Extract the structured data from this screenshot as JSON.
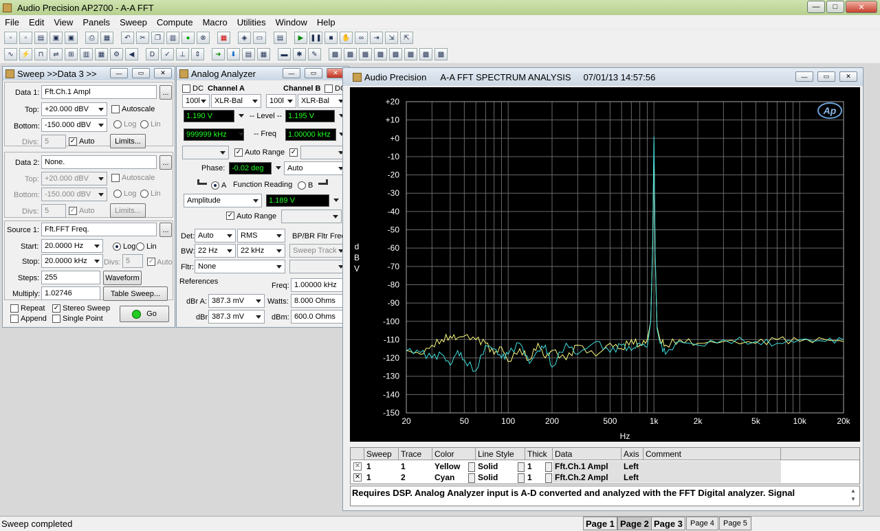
{
  "app": {
    "title": "Audio Precision AP2700 - A-A FFT"
  },
  "menu": [
    "File",
    "Edit",
    "View",
    "Panels",
    "Sweep",
    "Compute",
    "Macro",
    "Utilities",
    "Window",
    "Help"
  ],
  "sweep_panel": {
    "title": "Sweep >>Data 3 >>",
    "data1_label": "Data 1:",
    "data1_value": "Fft.Ch.1 Ampl",
    "top_label": "Top:",
    "top_value": "+20.000  dBV",
    "bottom_label": "Bottom:",
    "bottom_value": "-150.000 dBV",
    "divs_label": "Divs:",
    "divs_value": "5",
    "auto_label": "Auto",
    "limits_button": "Limits...",
    "autoscale_label": "Autoscale",
    "log_label": "Log",
    "lin_label": "Lin",
    "data2_label": "Data 2:",
    "data2_value": "None.",
    "top2_value": "+20.000  dBV",
    "bottom2_value": "-150.000 dBV",
    "divs2_value": "5",
    "source1_label": "Source 1:",
    "source1_value": "Fft.FFT Freq.",
    "start_label": "Start:",
    "start_value": "20.0000  Hz",
    "stop_label": "Stop:",
    "stop_value": "20.0000 kHz",
    "src_divs_value": "5",
    "steps_label": "Steps:",
    "steps_value": "255",
    "waveform_button": "Waveform",
    "multiply_label": "Multiply:",
    "multiply_value": "1.02746",
    "table_sweep_button": "Table Sweep...",
    "repeat_label": "Repeat",
    "stereo_label": "Stereo Sweep",
    "append_label": "Append",
    "single_label": "Single Point",
    "go_button": "Go",
    "ellipsis": "..."
  },
  "analyzer_panel": {
    "title": "Analog Analyzer",
    "dc_label": "DC",
    "channel_a": "Channel A",
    "channel_b": "Channel B",
    "range_a": "100l",
    "input_a": "XLR-Bal",
    "range_b": "100l",
    "input_b": "XLR-Bal",
    "level_a": "1.190    V",
    "level_label": "-- Level --",
    "level_b": "1.195    V",
    "freq_a": "999999 kHz",
    "freq_label": "-- Freq",
    "freq_b": "1.00000 kHz",
    "auto_range_label": "Auto Range",
    "phase_label": "Phase:",
    "phase_value": "-0.02   deg",
    "phase_mode": "Auto",
    "function_reading_label": "Function Reading",
    "a_label": "A",
    "b_label": "B",
    "function_value": "Amplitude",
    "reading_value": "1.189     V",
    "auto_range2_label": "Auto Range",
    "det_label": "Det:",
    "det_value": "Auto",
    "det_mode": "RMS",
    "bpbr_label": "BP/BR Fltr Freq",
    "bw_label": "BW:",
    "bw_low": "22 Hz",
    "bw_high": "22 kHz",
    "sweep_track": "Sweep Track",
    "fltr_label": "Fltr:",
    "fltr_value": "None",
    "references_label": "References",
    "ref_freq_label": "Freq:",
    "ref_freq_value": "1.00000 kHz",
    "dbra_label": "dBr A:",
    "dbra_value": "387.3    mV",
    "watts_label": "Watts:",
    "watts_value": "8.000    Ohms",
    "dbr_label": "dBr",
    "dbr_value": "387.3    mV",
    "dbm_label": "dBm:",
    "dbm_value": "600.0    Ohms"
  },
  "graph_window": {
    "title_app": "Audio Precision",
    "title_analysis": "A-A FFT SPECTRUM ANALYSIS",
    "title_time": "07/01/13 14:57:56",
    "logo": "Ap",
    "ylabel": "dBV",
    "xlabel": "Hz"
  },
  "chart_data": {
    "type": "line",
    "xscale": "log",
    "xlim": [
      20,
      20000
    ],
    "ylim": [
      -150,
      20
    ],
    "yticks": [
      "+20",
      "+10",
      "+0",
      "-10",
      "-20",
      "-30",
      "-40",
      "-50",
      "-60",
      "-70",
      "-80",
      "-90",
      "-100",
      "-110",
      "-120",
      "-130",
      "-140",
      "-150"
    ],
    "ytick_values": [
      20,
      10,
      0,
      -10,
      -20,
      -30,
      -40,
      -50,
      -60,
      -70,
      -80,
      -90,
      -100,
      -110,
      -120,
      -130,
      -140,
      -150
    ],
    "xticks": [
      "20",
      "50",
      "100",
      "200",
      "500",
      "1k",
      "2k",
      "5k",
      "10k",
      "20k"
    ],
    "xtick_values": [
      20,
      50,
      100,
      200,
      500,
      1000,
      2000,
      5000,
      10000,
      20000
    ],
    "xlabel": "Hz",
    "ylabel": "dBV",
    "grid": true,
    "series": [
      {
        "name": "Fft.Ch.1 Ampl",
        "color": "#ffff80",
        "x": [
          20,
          25,
          30,
          35,
          40,
          45,
          50,
          60,
          70,
          80,
          90,
          100,
          120,
          140,
          160,
          180,
          200,
          250,
          300,
          400,
          500,
          600,
          700,
          800,
          900,
          950,
          980,
          1000,
          1020,
          1050,
          1100,
          1200,
          1500,
          2000,
          3000,
          5000,
          7000,
          10000,
          15000,
          20000
        ],
        "y": [
          -116,
          -118,
          -113,
          -110,
          -108,
          -109,
          -108,
          -110,
          -112,
          -118,
          -114,
          -122,
          -115,
          -121,
          -112,
          -120,
          -116,
          -121,
          -113,
          -119,
          -112,
          -115,
          -110,
          -113,
          -110,
          -100,
          -60,
          -3,
          -65,
          -103,
          -110,
          -113,
          -110,
          -112,
          -111,
          -112,
          -110,
          -111,
          -110,
          -111
        ]
      },
      {
        "name": "Fft.Ch.2 Ampl",
        "color": "#40e0e0",
        "x": [
          20,
          25,
          30,
          35,
          40,
          45,
          50,
          60,
          70,
          80,
          90,
          100,
          120,
          140,
          160,
          180,
          200,
          250,
          300,
          400,
          500,
          600,
          700,
          800,
          900,
          950,
          980,
          1000,
          1020,
          1050,
          1100,
          1200,
          1500,
          2000,
          3000,
          5000,
          7000,
          10000,
          15000,
          20000
        ],
        "y": [
          -116,
          -117,
          -120,
          -118,
          -124,
          -116,
          -121,
          -127,
          -113,
          -115,
          -120,
          -118,
          -112,
          -123,
          -116,
          -113,
          -125,
          -112,
          -118,
          -111,
          -117,
          -113,
          -116,
          -112,
          -114,
          -100,
          -58,
          1,
          -62,
          -104,
          -112,
          -118,
          -111,
          -113,
          -110,
          -111,
          -112,
          -110,
          -111,
          -110
        ]
      }
    ]
  },
  "trace_table": {
    "headers": [
      "Sweep",
      "Trace",
      "Color",
      "Line Style",
      "Thick",
      "Data",
      "Axis",
      "Comment"
    ],
    "rows": [
      {
        "sweep": "1",
        "trace": "1",
        "color": "Yellow",
        "style": "Solid",
        "thick": "1",
        "data": "Fft.Ch.1 Ampl",
        "axis": "Left",
        "comment": ""
      },
      {
        "sweep": "1",
        "trace": "2",
        "color": "Cyan",
        "style": "Solid",
        "thick": "1",
        "data": "Fft.Ch.2 Ampl",
        "axis": "Left",
        "comment": ""
      }
    ]
  },
  "comment_text": "Requires DSP.  Analog Analyzer input is A-D converted and analyzed with the FFT Digital analyzer.  Signal",
  "status": {
    "text": "Sweep completed"
  },
  "pages": [
    "Page 1",
    "Page 2",
    "Page 3",
    "Page 4",
    "Page 5"
  ]
}
